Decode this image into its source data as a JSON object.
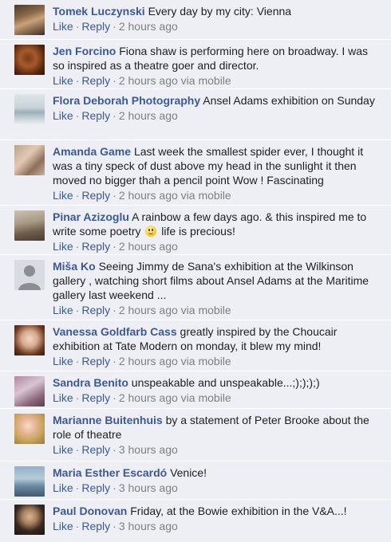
{
  "actions": {
    "like": "Like",
    "reply": "Reply",
    "sep": "·"
  },
  "comments": [
    {
      "author": "Tomek Luczynski",
      "text": "Every day by my city: Vienna",
      "time": "2 hours ago",
      "via": ""
    },
    {
      "author": "Jen Forcino",
      "text": "Fiona shaw is performing here on broadway. I was so inspired as a theatre goer and director.",
      "time": "2 hours ago",
      "via": "via mobile"
    },
    {
      "author": "Flora Deborah Photography",
      "text": "Ansel Adams exhibition on Sunday",
      "time": "2 hours ago",
      "via": ""
    },
    {
      "author": "Amanda Game",
      "text": "Last week the smallest spider ever, I thought it was a tiny speck of dust above my head in the sunlight it then moved no bigger thah a pencil point Wow ! Fascinating",
      "time": "2 hours ago",
      "via": "via mobile"
    },
    {
      "author": "Pinar Azizoglu",
      "text_before": "A rainbow a few days ago. & this inspired me to write some poetry",
      "text_after": "life is precious!",
      "time": "2 hours ago",
      "via": ""
    },
    {
      "author": "Miša Ko",
      "text": "Seeing Jimmy de Sana's exhibition at the Wilkinson gallery , watching short films about Ansel Adams at the Maritime gallery last weekend ...",
      "time": "2 hours ago",
      "via": "via mobile"
    },
    {
      "author": "Vanessa Goldfarb Cass",
      "text": "greatly inspired by the Choucair exhibition at Tate Modern on monday, it blew my mind!",
      "time": "2 hours ago",
      "via": "via mobile"
    },
    {
      "author": "Sandra Benito",
      "text": "unspeakable and unspeakable...;);););)",
      "time": "2 hours ago",
      "via": "via mobile"
    },
    {
      "author": "Marianne Buitenhuis",
      "text": "by a statement of Peter Brooke about the role of theatre",
      "time": "3 hours ago",
      "via": ""
    },
    {
      "author": "Maria Esther Escardó",
      "text": "Venice!",
      "time": "3 hours ago",
      "via": ""
    },
    {
      "author": "Paul Donovan",
      "text": "Friday, at the Bowie exhibition in the V&A...!",
      "time": "3 hours ago",
      "via": ""
    }
  ]
}
